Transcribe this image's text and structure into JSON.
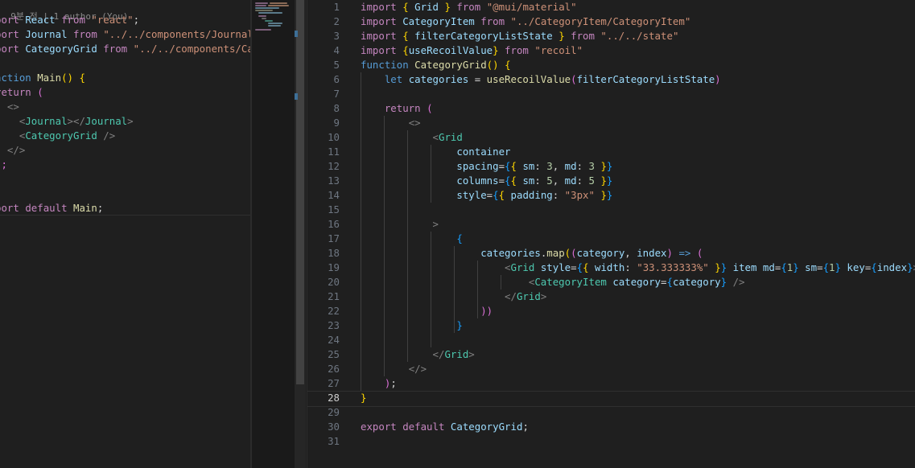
{
  "left_editor": {
    "codelens": ", 9분 전 | 1 author (You)",
    "lines": [
      {
        "tokens": [
          {
            "t": "port ",
            "c": "kw"
          },
          {
            "t": "React ",
            "c": "var"
          },
          {
            "t": "from ",
            "c": "kw"
          },
          {
            "t": "\"react\"",
            "c": "str"
          },
          {
            "t": ";",
            "c": "pl"
          }
        ]
      },
      {
        "tokens": [
          {
            "t": "port ",
            "c": "kw"
          },
          {
            "t": "Journal ",
            "c": "var"
          },
          {
            "t": "from ",
            "c": "kw"
          },
          {
            "t": "\"../../components/Journal/",
            "c": "str"
          }
        ]
      },
      {
        "tokens": [
          {
            "t": "port ",
            "c": "kw"
          },
          {
            "t": "CategoryGrid ",
            "c": "var"
          },
          {
            "t": "from ",
            "c": "kw"
          },
          {
            "t": "\"../../components/Cat",
            "c": "str"
          }
        ]
      },
      {
        "tokens": []
      },
      {
        "tokens": [
          {
            "t": "nction ",
            "c": "kw2"
          },
          {
            "t": "Main",
            "c": "fn"
          },
          {
            "t": "() ",
            "c": "br1"
          },
          {
            "t": "{",
            "c": "br1"
          }
        ]
      },
      {
        "tokens": [
          {
            "t": "return ",
            "c": "kw"
          },
          {
            "t": "(",
            "c": "br2"
          }
        ]
      },
      {
        "tokens": [
          {
            "t": "  ",
            "c": "pl"
          },
          {
            "t": "<>",
            "c": "punc"
          }
        ]
      },
      {
        "tokens": [
          {
            "t": "    ",
            "c": "pl"
          },
          {
            "t": "<",
            "c": "punc"
          },
          {
            "t": "Journal",
            "c": "tag"
          },
          {
            "t": "></",
            "c": "punc"
          },
          {
            "t": "Journal",
            "c": "tag"
          },
          {
            "t": ">",
            "c": "punc"
          }
        ]
      },
      {
        "tokens": [
          {
            "t": "    ",
            "c": "pl"
          },
          {
            "t": "<",
            "c": "punc"
          },
          {
            "t": "CategoryGrid",
            "c": "tag"
          },
          {
            "t": " />",
            "c": "punc"
          }
        ]
      },
      {
        "tokens": [
          {
            "t": "  ",
            "c": "pl"
          },
          {
            "t": "</>",
            "c": "punc"
          }
        ]
      },
      {
        "tokens": [
          {
            "t": ");",
            "c": "br2"
          }
        ]
      },
      {
        "tokens": []
      },
      {
        "tokens": []
      },
      {
        "tokens": [
          {
            "t": "port ",
            "c": "kw"
          },
          {
            "t": "default ",
            "c": "kw"
          },
          {
            "t": "Main",
            "c": "fn"
          },
          {
            "t": ";",
            "c": "pl"
          }
        ]
      }
    ]
  },
  "right_editor": {
    "active_line": 28,
    "lines": [
      {
        "n": "1",
        "tokens": [
          {
            "t": "import ",
            "c": "kw"
          },
          {
            "t": "{ ",
            "c": "br1"
          },
          {
            "t": "Grid ",
            "c": "var"
          },
          {
            "t": "} ",
            "c": "br1"
          },
          {
            "t": "from ",
            "c": "kw"
          },
          {
            "t": "\"@mui/material\"",
            "c": "str"
          }
        ]
      },
      {
        "n": "2",
        "tokens": [
          {
            "t": "import ",
            "c": "kw"
          },
          {
            "t": "CategoryItem ",
            "c": "var"
          },
          {
            "t": "from ",
            "c": "kw"
          },
          {
            "t": "\"../CategoryItem/CategoryItem\"",
            "c": "str"
          }
        ]
      },
      {
        "n": "3",
        "tokens": [
          {
            "t": "import ",
            "c": "kw"
          },
          {
            "t": "{ ",
            "c": "br1"
          },
          {
            "t": "filterCategoryListState ",
            "c": "var"
          },
          {
            "t": "} ",
            "c": "br1"
          },
          {
            "t": "from ",
            "c": "kw"
          },
          {
            "t": "\"../../state\"",
            "c": "str"
          }
        ]
      },
      {
        "n": "4",
        "tokens": [
          {
            "t": "import ",
            "c": "kw"
          },
          {
            "t": "{",
            "c": "br1"
          },
          {
            "t": "useRecoilValue",
            "c": "var"
          },
          {
            "t": "} ",
            "c": "br1"
          },
          {
            "t": "from ",
            "c": "kw"
          },
          {
            "t": "\"recoil\"",
            "c": "str"
          }
        ]
      },
      {
        "n": "5",
        "tokens": [
          {
            "t": "function ",
            "c": "kw2"
          },
          {
            "t": "CategoryGrid",
            "c": "fn"
          },
          {
            "t": "() ",
            "c": "br1"
          },
          {
            "t": "{",
            "c": "br1"
          }
        ]
      },
      {
        "n": "6",
        "tokens": [
          {
            "t": "    ",
            "c": "pl"
          },
          {
            "t": "let ",
            "c": "kw2"
          },
          {
            "t": "categories ",
            "c": "var"
          },
          {
            "t": "= ",
            "c": "pl"
          },
          {
            "t": "useRecoilValue",
            "c": "fn"
          },
          {
            "t": "(",
            "c": "br2"
          },
          {
            "t": "filterCategoryListState",
            "c": "var"
          },
          {
            "t": ")",
            "c": "br2"
          }
        ]
      },
      {
        "n": "7",
        "tokens": []
      },
      {
        "n": "8",
        "tokens": [
          {
            "t": "    ",
            "c": "pl"
          },
          {
            "t": "return ",
            "c": "kw"
          },
          {
            "t": "(",
            "c": "br2"
          }
        ]
      },
      {
        "n": "9",
        "tokens": [
          {
            "t": "        ",
            "c": "pl"
          },
          {
            "t": "<>",
            "c": "punc"
          }
        ]
      },
      {
        "n": "10",
        "tokens": [
          {
            "t": "            ",
            "c": "pl"
          },
          {
            "t": "<",
            "c": "punc"
          },
          {
            "t": "Grid",
            "c": "tag"
          }
        ]
      },
      {
        "n": "11",
        "tokens": [
          {
            "t": "                ",
            "c": "pl"
          },
          {
            "t": "container",
            "c": "var"
          }
        ]
      },
      {
        "n": "12",
        "tokens": [
          {
            "t": "                ",
            "c": "pl"
          },
          {
            "t": "spacing",
            "c": "var"
          },
          {
            "t": "=",
            "c": "pl"
          },
          {
            "t": "{",
            "c": "br3"
          },
          {
            "t": "{ ",
            "c": "br1"
          },
          {
            "t": "sm",
            "c": "var"
          },
          {
            "t": ": ",
            "c": "pl"
          },
          {
            "t": "3",
            "c": "num"
          },
          {
            "t": ", ",
            "c": "pl"
          },
          {
            "t": "md",
            "c": "var"
          },
          {
            "t": ": ",
            "c": "pl"
          },
          {
            "t": "3 ",
            "c": "num"
          },
          {
            "t": "}",
            "c": "br1"
          },
          {
            "t": "}",
            "c": "br3"
          }
        ]
      },
      {
        "n": "13",
        "tokens": [
          {
            "t": "                ",
            "c": "pl"
          },
          {
            "t": "columns",
            "c": "var"
          },
          {
            "t": "=",
            "c": "pl"
          },
          {
            "t": "{",
            "c": "br3"
          },
          {
            "t": "{ ",
            "c": "br1"
          },
          {
            "t": "sm",
            "c": "var"
          },
          {
            "t": ": ",
            "c": "pl"
          },
          {
            "t": "5",
            "c": "num"
          },
          {
            "t": ", ",
            "c": "pl"
          },
          {
            "t": "md",
            "c": "var"
          },
          {
            "t": ": ",
            "c": "pl"
          },
          {
            "t": "5 ",
            "c": "num"
          },
          {
            "t": "}",
            "c": "br1"
          },
          {
            "t": "}",
            "c": "br3"
          }
        ]
      },
      {
        "n": "14",
        "tokens": [
          {
            "t": "                ",
            "c": "pl"
          },
          {
            "t": "style",
            "c": "var"
          },
          {
            "t": "=",
            "c": "pl"
          },
          {
            "t": "{",
            "c": "br3"
          },
          {
            "t": "{ ",
            "c": "br1"
          },
          {
            "t": "padding",
            "c": "var"
          },
          {
            "t": ": ",
            "c": "pl"
          },
          {
            "t": "\"3px\" ",
            "c": "str"
          },
          {
            "t": "}",
            "c": "br1"
          },
          {
            "t": "}",
            "c": "br3"
          }
        ]
      },
      {
        "n": "15",
        "tokens": []
      },
      {
        "n": "16",
        "tokens": [
          {
            "t": "            ",
            "c": "pl"
          },
          {
            "t": ">",
            "c": "punc"
          }
        ]
      },
      {
        "n": "17",
        "tokens": [
          {
            "t": "                ",
            "c": "pl"
          },
          {
            "t": "{",
            "c": "br3"
          }
        ]
      },
      {
        "n": "18",
        "tokens": [
          {
            "t": "                    ",
            "c": "pl"
          },
          {
            "t": "categories",
            "c": "var"
          },
          {
            "t": ".",
            "c": "pl"
          },
          {
            "t": "map",
            "c": "fn"
          },
          {
            "t": "(",
            "c": "br1"
          },
          {
            "t": "(",
            "c": "br2"
          },
          {
            "t": "category",
            "c": "var"
          },
          {
            "t": ", ",
            "c": "pl"
          },
          {
            "t": "index",
            "c": "var"
          },
          {
            "t": ") ",
            "c": "br2"
          },
          {
            "t": "=> ",
            "c": "kw2"
          },
          {
            "t": "(",
            "c": "br2"
          }
        ]
      },
      {
        "n": "19",
        "tokens": [
          {
            "t": "                        ",
            "c": "pl"
          },
          {
            "t": "<",
            "c": "punc"
          },
          {
            "t": "Grid ",
            "c": "tag"
          },
          {
            "t": "style",
            "c": "var"
          },
          {
            "t": "=",
            "c": "pl"
          },
          {
            "t": "{",
            "c": "br3"
          },
          {
            "t": "{ ",
            "c": "br1"
          },
          {
            "t": "width",
            "c": "var"
          },
          {
            "t": ": ",
            "c": "pl"
          },
          {
            "t": "\"33.333333%\" ",
            "c": "str"
          },
          {
            "t": "}",
            "c": "br1"
          },
          {
            "t": "} ",
            "c": "br3"
          },
          {
            "t": "item ",
            "c": "var"
          },
          {
            "t": "md",
            "c": "var"
          },
          {
            "t": "=",
            "c": "pl"
          },
          {
            "t": "{",
            "c": "br3"
          },
          {
            "t": "1",
            "c": "num"
          },
          {
            "t": "} ",
            "c": "br3"
          },
          {
            "t": "sm",
            "c": "var"
          },
          {
            "t": "=",
            "c": "pl"
          },
          {
            "t": "{",
            "c": "br3"
          },
          {
            "t": "1",
            "c": "num"
          },
          {
            "t": "} ",
            "c": "br3"
          },
          {
            "t": "key",
            "c": "var"
          },
          {
            "t": "=",
            "c": "pl"
          },
          {
            "t": "{",
            "c": "br3"
          },
          {
            "t": "index",
            "c": "var"
          },
          {
            "t": "}",
            "c": "br3"
          },
          {
            "t": ">",
            "c": "punc"
          }
        ]
      },
      {
        "n": "20",
        "tokens": [
          {
            "t": "                            ",
            "c": "pl"
          },
          {
            "t": "<",
            "c": "punc"
          },
          {
            "t": "CategoryItem ",
            "c": "tag"
          },
          {
            "t": "category",
            "c": "var"
          },
          {
            "t": "=",
            "c": "pl"
          },
          {
            "t": "{",
            "c": "br3"
          },
          {
            "t": "category",
            "c": "var"
          },
          {
            "t": "} ",
            "c": "br3"
          },
          {
            "t": "/>",
            "c": "punc"
          }
        ]
      },
      {
        "n": "21",
        "tokens": [
          {
            "t": "                        ",
            "c": "pl"
          },
          {
            "t": "</",
            "c": "punc"
          },
          {
            "t": "Grid",
            "c": "tag"
          },
          {
            "t": ">",
            "c": "punc"
          }
        ]
      },
      {
        "n": "22",
        "tokens": [
          {
            "t": "                    ",
            "c": "pl"
          },
          {
            "t": "))",
            "c": "br2"
          }
        ]
      },
      {
        "n": "23",
        "tokens": [
          {
            "t": "                ",
            "c": "pl"
          },
          {
            "t": "}",
            "c": "br3"
          }
        ]
      },
      {
        "n": "24",
        "tokens": []
      },
      {
        "n": "25",
        "tokens": [
          {
            "t": "            ",
            "c": "pl"
          },
          {
            "t": "</",
            "c": "punc"
          },
          {
            "t": "Grid",
            "c": "tag"
          },
          {
            "t": ">",
            "c": "punc"
          }
        ]
      },
      {
        "n": "26",
        "tokens": [
          {
            "t": "        ",
            "c": "pl"
          },
          {
            "t": "</>",
            "c": "punc"
          }
        ]
      },
      {
        "n": "27",
        "tokens": [
          {
            "t": "    ",
            "c": "pl"
          },
          {
            "t": ")",
            "c": "br2"
          },
          {
            "t": ";",
            "c": "pl"
          }
        ]
      },
      {
        "n": "28",
        "tokens": [
          {
            "t": "}",
            "c": "br1"
          }
        ]
      },
      {
        "n": "29",
        "tokens": []
      },
      {
        "n": "30",
        "tokens": [
          {
            "t": "export ",
            "c": "kw"
          },
          {
            "t": "default ",
            "c": "kw"
          },
          {
            "t": "CategoryGrid",
            "c": "var"
          },
          {
            "t": ";",
            "c": "pl"
          }
        ]
      },
      {
        "n": "31",
        "tokens": []
      }
    ]
  }
}
